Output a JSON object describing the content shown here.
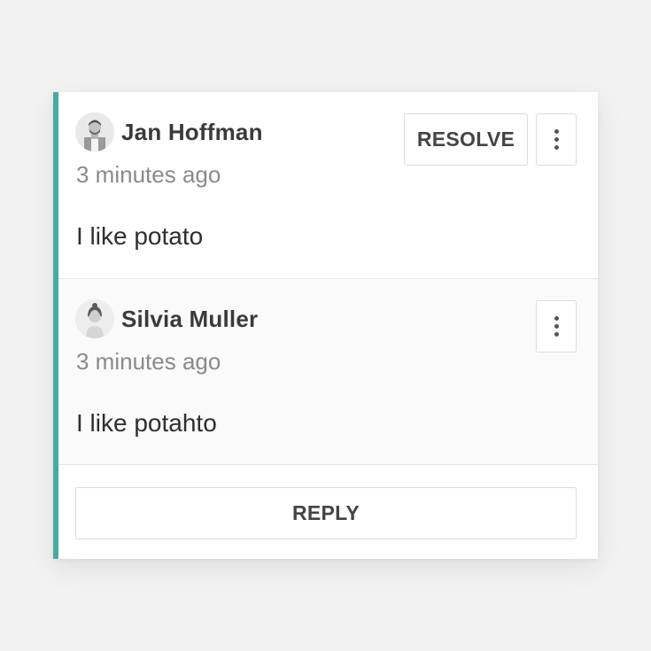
{
  "thread": {
    "accent_color": "#4aa9a0",
    "comments": [
      {
        "author": "Jan Hoffman",
        "timestamp": "3 minutes ago",
        "text": "I like potato",
        "avatar_icon": "person-avatar-male"
      },
      {
        "author": "Silvia Muller",
        "timestamp": "3 minutes ago",
        "text": "I like potahto",
        "avatar_icon": "person-avatar-female"
      }
    ],
    "resolve_label": "RESOLVE",
    "reply_label": "REPLY",
    "more_icon": "more-vertical-icon"
  }
}
